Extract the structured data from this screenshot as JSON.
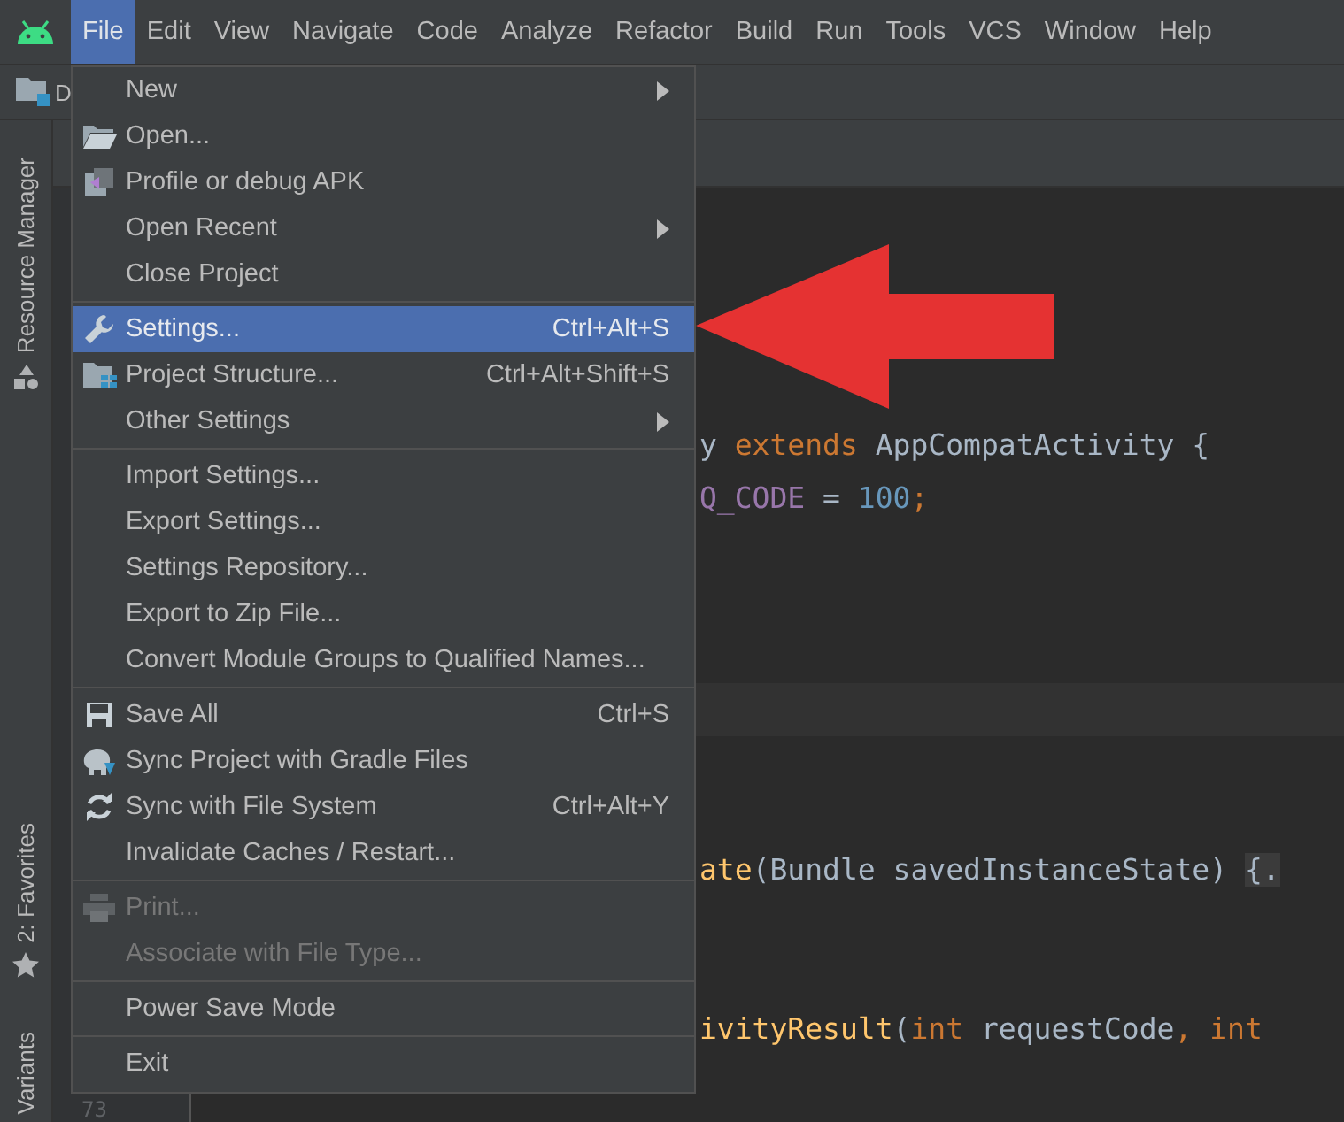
{
  "menubar": [
    {
      "label": "File",
      "selected": true
    },
    {
      "label": "Edit",
      "selected": false
    },
    {
      "label": "View",
      "selected": false
    },
    {
      "label": "Navigate",
      "selected": false
    },
    {
      "label": "Code",
      "selected": false
    },
    {
      "label": "Analyze",
      "selected": false
    },
    {
      "label": "Refactor",
      "selected": false
    },
    {
      "label": "Build",
      "selected": false
    },
    {
      "label": "Run",
      "selected": false
    },
    {
      "label": "Tools",
      "selected": false
    },
    {
      "label": "VCS",
      "selected": false
    },
    {
      "label": "Window",
      "selected": false
    },
    {
      "label": "Help",
      "selected": false
    }
  ],
  "tool_windows": [
    {
      "label": "Resource Manager"
    },
    {
      "label": "2: Favorites"
    },
    {
      "label": "Variants"
    }
  ],
  "navigation_bar": {
    "crumb": "D"
  },
  "editor": {
    "lines": [
      [
        {
          "kind": "plain",
          "text": "y "
        },
        {
          "kind": "keyword",
          "text": "extends"
        },
        {
          "kind": "plain",
          "text": " AppCompatActivity {"
        }
      ],
      [
        {
          "kind": "field",
          "text": "Q_CODE"
        },
        {
          "kind": "plain",
          "text": " = "
        },
        {
          "kind": "number",
          "text": "100"
        },
        {
          "kind": "keyword",
          "text": ";"
        }
      ],
      [
        {
          "kind": "method",
          "text": "ate"
        },
        {
          "kind": "plain",
          "text": "(Bundle savedInstanceState) "
        },
        {
          "kind": "fold",
          "text": "{."
        }
      ],
      [
        {
          "kind": "method",
          "text": "ivityResult"
        },
        {
          "kind": "plain",
          "text": "("
        },
        {
          "kind": "keyword",
          "text": "int"
        },
        {
          "kind": "plain",
          "text": " requestCode"
        },
        {
          "kind": "keyword",
          "text": ", int"
        }
      ]
    ],
    "line_number": "73"
  },
  "file_menu": {
    "items": [
      {
        "kind": "item",
        "label": "New",
        "submenu": true,
        "selected": false,
        "disabled": false
      },
      {
        "kind": "item",
        "label": "Open...",
        "submenu": false,
        "selected": false,
        "disabled": false
      },
      {
        "kind": "item",
        "label": "Profile or debug APK",
        "submenu": false,
        "selected": false,
        "disabled": false
      },
      {
        "kind": "item",
        "label": "Open Recent",
        "submenu": true,
        "selected": false,
        "disabled": false
      },
      {
        "kind": "item",
        "label": "Close Project",
        "submenu": false,
        "selected": false,
        "disabled": false
      },
      {
        "kind": "separator"
      },
      {
        "kind": "item",
        "label": "Settings...",
        "shortcut": "Ctrl+Alt+S",
        "submenu": false,
        "selected": true,
        "disabled": false
      },
      {
        "kind": "item",
        "label": "Project Structure...",
        "shortcut": "Ctrl+Alt+Shift+S",
        "submenu": false,
        "selected": false,
        "disabled": false
      },
      {
        "kind": "item",
        "label": "Other Settings",
        "submenu": true,
        "selected": false,
        "disabled": false
      },
      {
        "kind": "separator"
      },
      {
        "kind": "item",
        "label": "Import Settings...",
        "submenu": false,
        "selected": false,
        "disabled": false
      },
      {
        "kind": "item",
        "label": "Export Settings...",
        "submenu": false,
        "selected": false,
        "disabled": false
      },
      {
        "kind": "item",
        "label": "Settings Repository...",
        "submenu": false,
        "selected": false,
        "disabled": false
      },
      {
        "kind": "item",
        "label": "Export to Zip File...",
        "submenu": false,
        "selected": false,
        "disabled": false
      },
      {
        "kind": "item",
        "label": "Convert Module Groups to Qualified Names...",
        "submenu": false,
        "selected": false,
        "disabled": false
      },
      {
        "kind": "separator"
      },
      {
        "kind": "item",
        "label": "Save All",
        "shortcut": "Ctrl+S",
        "submenu": false,
        "selected": false,
        "disabled": false
      },
      {
        "kind": "item",
        "label": "Sync Project with Gradle Files",
        "submenu": false,
        "selected": false,
        "disabled": false
      },
      {
        "kind": "item",
        "label": "Sync with File System",
        "shortcut": "Ctrl+Alt+Y",
        "submenu": false,
        "selected": false,
        "disabled": false
      },
      {
        "kind": "item",
        "label": "Invalidate Caches / Restart...",
        "submenu": false,
        "selected": false,
        "disabled": false
      },
      {
        "kind": "separator"
      },
      {
        "kind": "item",
        "label": "Print...",
        "submenu": false,
        "selected": false,
        "disabled": true
      },
      {
        "kind": "item",
        "label": "Associate with File Type...",
        "submenu": false,
        "selected": false,
        "disabled": true
      },
      {
        "kind": "separator"
      },
      {
        "kind": "item",
        "label": "Power Save Mode",
        "submenu": false,
        "selected": false,
        "disabled": false
      },
      {
        "kind": "separator"
      },
      {
        "kind": "item",
        "label": "Exit",
        "submenu": false,
        "selected": false,
        "disabled": false
      }
    ]
  }
}
